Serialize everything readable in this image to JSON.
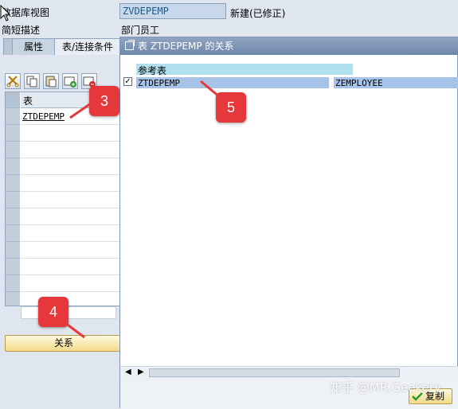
{
  "header": {
    "view_label": "数据库视图",
    "view_value": "ZVDEPEMP",
    "view_status": "新建(已修正)",
    "desc_label": "简短描述",
    "desc_value": "部门员工"
  },
  "tabs": [
    {
      "label": "属性",
      "active": false
    },
    {
      "label": "表/连接条件",
      "active": true
    }
  ],
  "left_grid": {
    "column_header": "表",
    "rows": [
      "ZTDEPEMP"
    ]
  },
  "relation_button": "关系",
  "dialog": {
    "title": "表 ZTDEPEMP 的关系",
    "tree_header": "参考表",
    "rows": [
      {
        "checked": true,
        "table": "ZTDEPEMP",
        "ref": "ZEMPLOYEE"
      }
    ],
    "copy_button": "复制"
  },
  "callouts": [
    "3",
    "4",
    "5"
  ],
  "watermark": "知乎 @MR.Geekery",
  "colors": {
    "callout": "#e6383b",
    "dialog_title": "#7f97b3",
    "selected_row": "#a7c3e8"
  }
}
